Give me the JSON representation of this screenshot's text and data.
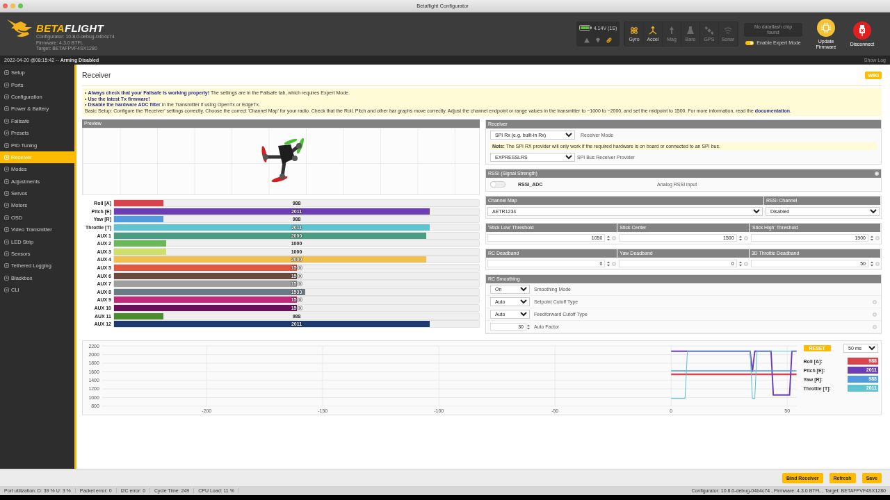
{
  "window": {
    "title": "Betaflight Configurator"
  },
  "header": {
    "logo": [
      "BETA",
      "FLIGHT"
    ],
    "version_lines": [
      "Configurator: 10.8.0-debug-04b4c74",
      "Firmware: 4.3.0 BTFL",
      "Target: BETAFPVF4SX1280"
    ],
    "battery": "4.14V (1S)",
    "sensors": [
      {
        "label": "Gyro",
        "active": true
      },
      {
        "label": "Accel",
        "active": true
      },
      {
        "label": "Mag",
        "active": false
      },
      {
        "label": "Baro",
        "active": false
      },
      {
        "label": "GPS",
        "active": false
      },
      {
        "label": "Sonar",
        "active": false
      }
    ],
    "dataflash": "No dataflash chip found",
    "expert_mode": {
      "label": "Enable Expert Mode",
      "on": true
    },
    "buttons": [
      {
        "kind": "update",
        "label": "Update Firmware"
      },
      {
        "kind": "disconnect",
        "label": "Disconnect"
      }
    ]
  },
  "log_bar": {
    "status": "2022-04-20 @08:15:42 -- **Arming Disabled**",
    "show_log": "Show Log"
  },
  "sidebar": {
    "items": [
      {
        "label": "Setup",
        "selected": false
      },
      {
        "label": "Ports",
        "selected": false
      },
      {
        "label": "Configuration",
        "selected": false
      },
      {
        "label": "Power & Battery",
        "selected": false
      },
      {
        "label": "Failsafe",
        "selected": false
      },
      {
        "label": "Presets",
        "selected": false
      },
      {
        "label": "PID Tuning",
        "selected": false
      },
      {
        "label": "Receiver",
        "selected": true
      },
      {
        "label": "Modes",
        "selected": false
      },
      {
        "label": "Adjustments",
        "selected": false
      },
      {
        "label": "Servos",
        "selected": false
      },
      {
        "label": "Motors",
        "selected": false
      },
      {
        "label": "OSD",
        "selected": false
      },
      {
        "label": "Video Transmitter",
        "selected": false
      },
      {
        "label": "LED Strip",
        "selected": false
      },
      {
        "label": "Sensors",
        "selected": false
      },
      {
        "label": "Tethered Logging",
        "selected": false
      },
      {
        "label": "Blackbox",
        "selected": false
      },
      {
        "label": "CLI",
        "selected": false
      }
    ]
  },
  "page": {
    "title": "Receiver",
    "wiki": "WIKI",
    "notice": {
      "lines": [
        "• **Always check that your Failsafe is working properly!** The settings are in the Failsafe tab, which requires Expert Mode.",
        "• **Use the latest Tx firmware!**",
        "• **Disable the hardware ADC filter** in the Transmitter if using OpenTx or EdgeTx."
      ],
      "basic_setup": {
        "text": "Basic Setup: Configure the 'Receiver' settings correctly. Choose the correct 'Channel Map' for your radio. Check that the Roll, Pitch and other bar graphs move correctly. Adjust the channel endpoint or range values in the transmitter to ~1000 to ~2000, and set the midpoint to 1500. For more information, read the ",
        "link": "documentation",
        "tail": "."
      }
    },
    "preview": {
      "title": "Preview"
    },
    "channels": [
      {
        "label": "Roll [A]",
        "value": "988",
        "level": 0.136,
        "color": "#d9434b"
      },
      {
        "label": "Pitch [E]",
        "value": "2011",
        "level": 0.864,
        "color": "#6b3fb3"
      },
      {
        "label": "Yaw [R]",
        "value": "988",
        "level": 0.136,
        "color": "#4f9ae0"
      },
      {
        "label": "Throttle [T]",
        "value": "2011",
        "level": 0.864,
        "color": "#5fc4cf"
      },
      {
        "label": "AUX 1",
        "value": "2000",
        "level": 0.856,
        "color": "#4a9c82"
      },
      {
        "label": "AUX 2",
        "value": "1000",
        "level": 0.143,
        "color": "#6ab85a"
      },
      {
        "label": "AUX 3",
        "value": "1000",
        "level": 0.143,
        "color": "#cfe06a"
      },
      {
        "label": "AUX 4",
        "value": "2000",
        "level": 0.856,
        "color": "#f0c050"
      },
      {
        "label": "AUX 5",
        "value": "1500",
        "level": 0.5,
        "color": "#e0583f"
      },
      {
        "label": "AUX 6",
        "value": "1500",
        "level": 0.5,
        "color": "#6b4a3e"
      },
      {
        "label": "AUX 7",
        "value": "1500",
        "level": 0.5,
        "color": "#9e9e9e"
      },
      {
        "label": "AUX 8",
        "value": "1533",
        "level": 0.523,
        "color": "#6c7a86"
      },
      {
        "label": "AUX 9",
        "value": "1500",
        "level": 0.5,
        "color": "#c02a7a"
      },
      {
        "label": "AUX 10",
        "value": "1500",
        "level": 0.5,
        "color": "#6a0f5a"
      },
      {
        "label": "AUX 11",
        "value": "988",
        "level": 0.136,
        "color": "#4d8c2e"
      },
      {
        "label": "AUX 12",
        "value": "2011",
        "level": 0.864,
        "color": "#1f3a6e"
      }
    ],
    "receiver_panel": {
      "title": "Receiver",
      "mode": {
        "value": "SPI Rx (e.g. built-in Rx)",
        "label": "Receiver Mode"
      },
      "note": "**Note:** The SPI RX provider will only work if the required hardware is on board or connected to an SPI bus.",
      "provider": {
        "value": "EXPRESSLRS",
        "label": "SPI Bus Receiver Provider"
      }
    },
    "rssi_panel": {
      "title": "RSSI (Signal Strength)",
      "on": false,
      "name": "RSSI_ADC",
      "description": "Analog RSSI input"
    },
    "channel_map": {
      "columns": [
        {
          "title": "Channel Map",
          "value": "AETR1234"
        },
        {
          "title": "RSSI Channel",
          "value": "Disabled"
        }
      ]
    },
    "stick_panel": {
      "columns": [
        {
          "title": "'Stick Low' Threshold",
          "value": "1050"
        },
        {
          "title": "Stick Center",
          "value": "1500"
        },
        {
          "title": "'Stick High' Threshold",
          "value": "1900"
        }
      ]
    },
    "deadband_panel": {
      "columns": [
        {
          "title": "RC Deadband",
          "value": "0"
        },
        {
          "title": "Yaw Deadband",
          "value": "0"
        },
        {
          "title": "3D Throttle Deadband",
          "value": "50"
        }
      ]
    },
    "smoothing_panel": {
      "title": "RC Smoothing",
      "rows": [
        {
          "kind": "select",
          "value": "On",
          "label": "Smoothing Mode",
          "help": false
        },
        {
          "kind": "select",
          "value": "Auto",
          "label": "Setpoint Cutoff Type",
          "help": true
        },
        {
          "kind": "select",
          "value": "Auto",
          "label": "Feedforward Cutoff Type",
          "help": true
        },
        {
          "kind": "number",
          "value": "30",
          "label": "Auto Factor",
          "help": true
        }
      ]
    },
    "signal_graph": {
      "reset": "RESET",
      "interval": "50 ms",
      "legend": [
        {
          "label": "Roll [A]:",
          "value": "988",
          "color": "#d9434b"
        },
        {
          "label": "Pitch [E]:",
          "value": "2011",
          "color": "#6b3fb3"
        },
        {
          "label": "Yaw [R]:",
          "value": "988",
          "color": "#4f9ae0"
        },
        {
          "label": "Throttle [T]:",
          "value": "2011",
          "color": "#5fc4cf"
        }
      ],
      "chart_data": {
        "type": "line",
        "x": [
          0,
          6,
          7,
          34,
          35,
          36,
          37,
          43,
          44,
          51,
          52,
          54
        ],
        "series": [
          {
            "color": "#d9434b",
            "values": [
              1540,
              1540,
              1540,
              1540,
              1540,
              1540,
              1540,
              1540,
              1540,
              1540,
              1540,
              1540
            ]
          },
          {
            "color": "#6b3fb3",
            "values": [
              2080,
              2080,
              2080,
              2080,
              1600,
              2080,
              2080,
              2080,
              1060,
              1060,
              2080,
              2080
            ]
          },
          {
            "color": "#4f9ae0",
            "values": [
              1620,
              1620,
              1620,
              1620,
              1620,
              1620,
              1620,
              1620,
              1620,
              1620,
              1620,
              1620
            ]
          },
          {
            "color": "#5fc4cf",
            "values": [
              980,
              980,
              2080,
              2080,
              980,
              980,
              2080,
              2080,
              2080,
              2080,
              2080,
              2080
            ]
          }
        ],
        "xlim": [
          -245,
          54
        ],
        "ylim": [
          800,
          2200
        ],
        "xticks": [
          -200,
          -150,
          -100,
          -50,
          0,
          50
        ],
        "yticks": [
          800,
          1000,
          1200,
          1400,
          1600,
          1800,
          2000,
          2200
        ],
        "grid": true
      }
    }
  },
  "toolbar": {
    "buttons": [
      "Bind Receiver",
      "Refresh",
      "Save"
    ]
  },
  "status_bar": {
    "items": [
      "Port utilization: D: 39 % U: 3 %",
      "Packet error: 0",
      "I2C error: 0",
      "Cycle Time: 249",
      "CPU Load: 11 %"
    ],
    "versions": "Configurator: 10.8.0-debug-04b4c74 , Firmware: 4.3.0 BTFL , Target: BETAFPVF4SX1280"
  }
}
